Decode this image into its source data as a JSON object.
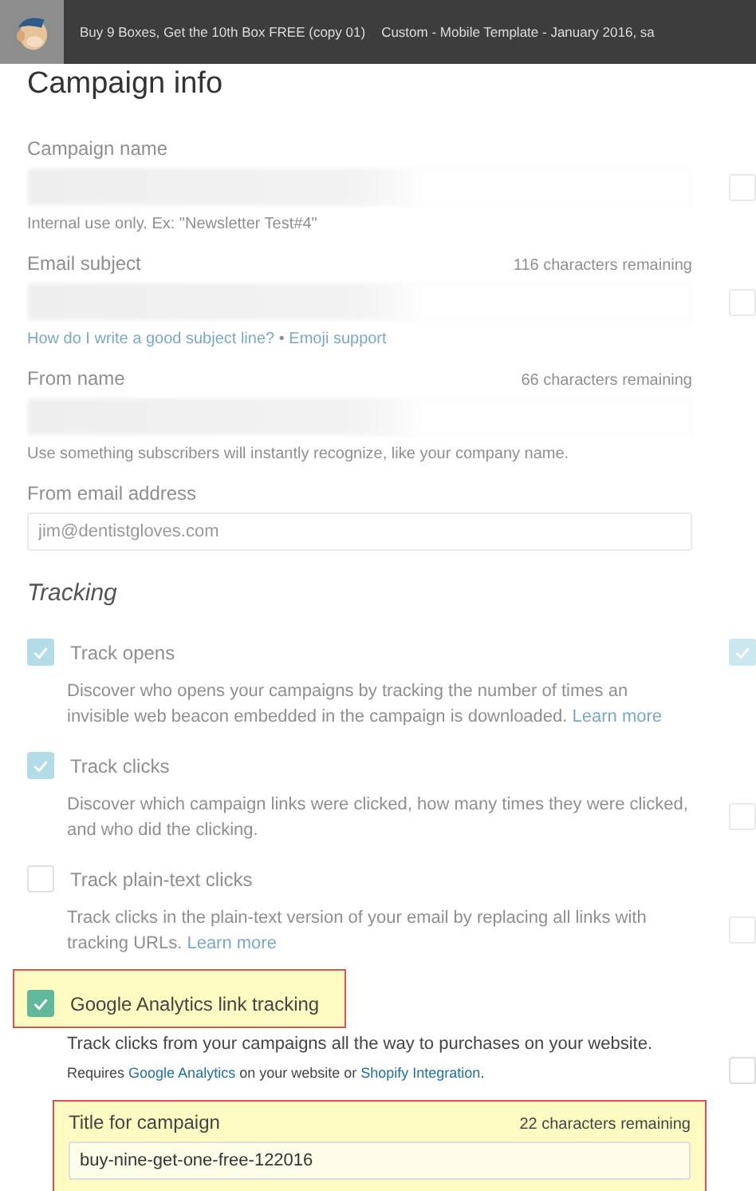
{
  "topbar": {
    "breadcrumbs": [
      "Buy 9 Boxes, Get the 10th Box FREE (copy 01)",
      "Custom - Mobile Template - January 2016, sa"
    ]
  },
  "heading": "Campaign info",
  "fields": [
    {
      "kind": "blurred",
      "label": "Campaign name",
      "help": [
        {
          "kind": "text",
          "text": "Internal use only. Ex: \"Newsletter Test#4\""
        }
      ],
      "faded": true,
      "side_checkbox": {
        "checked": false
      }
    },
    {
      "kind": "blurred",
      "label": "Email subject",
      "counter": "116 characters remaining",
      "help": [
        {
          "kind": "link",
          "text": "How do I write a good subject line?"
        },
        {
          "kind": "text",
          "text": " • "
        },
        {
          "kind": "link",
          "text": "Emoji support"
        }
      ],
      "faded": true,
      "side_checkbox": {
        "checked": false
      }
    },
    {
      "kind": "blurred",
      "label": "From name",
      "counter": "66 characters remaining",
      "help": [
        {
          "kind": "text",
          "text": "Use something subscribers will instantly recognize, like your company name."
        }
      ],
      "faded": true
    },
    {
      "kind": "text",
      "label": "From email address",
      "placeholder": "jim@dentistgloves.com",
      "faded": true
    }
  ],
  "tracking": {
    "heading": "Tracking",
    "options": [
      {
        "label": "Track opens",
        "checked": true,
        "faded": true,
        "highlighted": false,
        "description": [
          {
            "kind": "text",
            "text": "Discover who opens your campaigns by tracking the number of times an invisible web beacon embedded in the campaign is downloaded. "
          },
          {
            "kind": "link",
            "text": "Learn more"
          }
        ],
        "label_checkbox": {
          "checked": true
        }
      },
      {
        "label": "Track clicks",
        "checked": true,
        "faded": true,
        "highlighted": false,
        "description": [
          {
            "kind": "text",
            "text": "Discover which campaign links were clicked, how many times they were clicked, and who did the clicking."
          }
        ],
        "description_checkbox": {
          "checked": false
        }
      },
      {
        "label": "Track plain-text clicks",
        "checked": false,
        "faded": true,
        "highlighted": false,
        "description": [
          {
            "kind": "text",
            "text": "Track clicks in the plain-text version of your email by replacing all links with tracking URLs. "
          },
          {
            "kind": "link",
            "text": "Learn more"
          }
        ],
        "description_checkbox": {
          "checked": false
        }
      },
      {
        "label": "Google Analytics link tracking",
        "checked": true,
        "faded": false,
        "highlighted": true,
        "description": [
          {
            "kind": "text",
            "text": "Track clicks from your campaigns all the way to purchases on your website."
          }
        ],
        "note": [
          {
            "kind": "text",
            "text": "Requires "
          },
          {
            "kind": "link",
            "text": "Google Analytics"
          },
          {
            "kind": "text",
            "text": " on your website or "
          },
          {
            "kind": "link",
            "text": "Shopify Integration"
          },
          {
            "kind": "text",
            "text": "."
          }
        ],
        "note_checkbox": {
          "checked": false
        }
      }
    ]
  },
  "campaign_title": {
    "label": "Title for campaign",
    "counter": "22 characters remaining",
    "value": "buy-nine-get-one-free-122016",
    "highlighted": true
  }
}
